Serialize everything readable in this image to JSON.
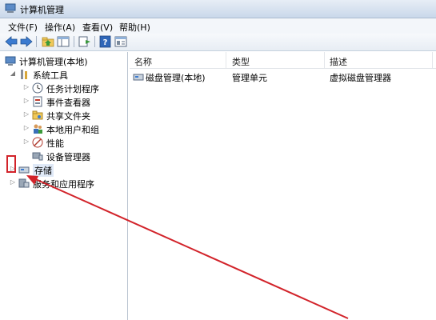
{
  "window": {
    "title": "计算机管理"
  },
  "menu": [
    "文件(F)",
    "操作(A)",
    "查看(V)",
    "帮助(H)"
  ],
  "toolbar": {
    "icons": [
      "back-arrow-icon",
      "forward-arrow-icon",
      "up-folder-icon",
      "show-hide-tree-icon",
      "export-list-icon",
      "help-icon",
      "properties-icon"
    ]
  },
  "tree": {
    "root": "计算机管理(本地)",
    "system_tools": "系统工具",
    "task_scheduler": "任务计划程序",
    "event_viewer": "事件查看器",
    "shared_folders": "共享文件夹",
    "local_users_groups": "本地用户和组",
    "performance": "性能",
    "device_manager": "设备管理器",
    "storage": "存储",
    "services_apps": "服务和应用程序"
  },
  "list": {
    "columns": [
      "名称",
      "类型",
      "描述"
    ],
    "rows": [
      {
        "name": "磁盘管理(本地)",
        "type": "管理单元",
        "desc": "虚拟磁盘管理器"
      }
    ]
  },
  "annotation": {
    "color": "#d2232a"
  }
}
